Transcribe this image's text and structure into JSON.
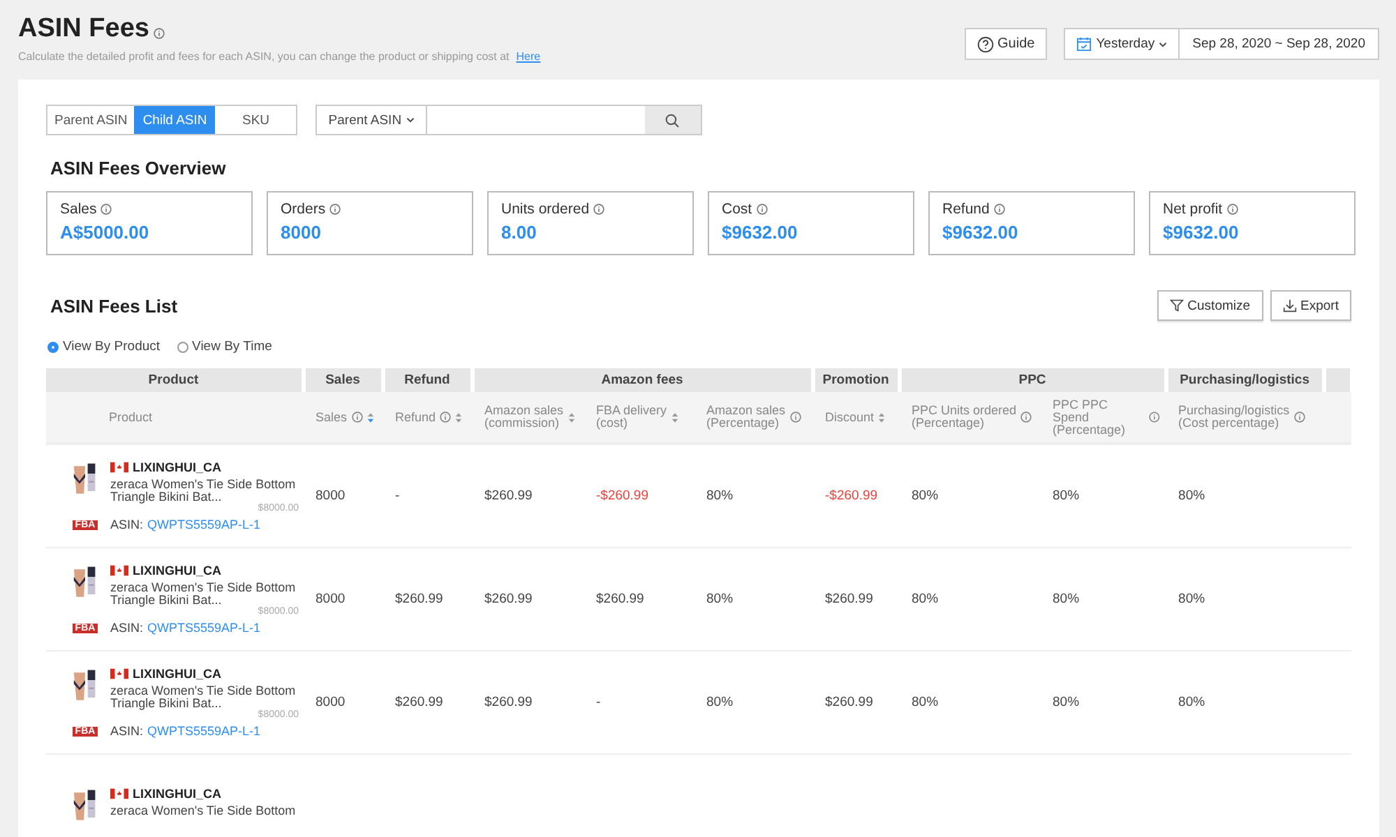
{
  "header": {
    "title": "ASIN Fees",
    "subtitle": "Calculate the detailed profit and fees for each ASIN, you can change the product or shipping cost at",
    "subtitle_link": "Here",
    "guide_button": "Guide",
    "period": "Yesterday",
    "date_range": "Sep 28, 2020 ~ Sep 28, 2020"
  },
  "tabs": [
    {
      "label": "Parent ASIN",
      "selected": false
    },
    {
      "label": "Child ASIN",
      "selected": true
    },
    {
      "label": "SKU",
      "selected": false
    }
  ],
  "search": {
    "scope": "Parent ASIN"
  },
  "overview": {
    "title": "ASIN Fees Overview",
    "cards": [
      {
        "label": "Sales",
        "value": "A$5000.00"
      },
      {
        "label": "Orders",
        "value": "8000"
      },
      {
        "label": "Units ordered",
        "value": "8.00"
      },
      {
        "label": "Cost",
        "value": "$9632.00"
      },
      {
        "label": "Refund",
        "value": "$9632.00"
      },
      {
        "label": "Net profit",
        "value": "$9632.00"
      }
    ]
  },
  "list": {
    "title": "ASIN Fees List",
    "buttons": [
      "Customize",
      "Export"
    ],
    "views": [
      {
        "label": "View By Product",
        "selected": true
      },
      {
        "label": "View By Time",
        "selected": false
      }
    ]
  },
  "table": {
    "groups": [
      {
        "label": "Product"
      },
      {
        "label": "Sales"
      },
      {
        "label": "Refund"
      },
      {
        "label": "Amazon fees"
      },
      {
        "label": "Promotion"
      },
      {
        "label": "PPC"
      },
      {
        "label": "Purchasing/logistics"
      }
    ],
    "columns": [
      {
        "label": "Product",
        "info": false,
        "sortable": false
      },
      {
        "label": "Sales",
        "info": true,
        "sortable": true,
        "sort_active": true
      },
      {
        "label": "Refund",
        "info": true,
        "sortable": true,
        "sort_active": false
      },
      {
        "label": "Amazon sales\n(commission)",
        "info": false,
        "sortable": true,
        "sort_active": false
      },
      {
        "label": "FBA delivery\n(cost)",
        "info": false,
        "sortable": true,
        "sort_active": false
      },
      {
        "label": "Amazon sales\n(Percentage)",
        "info": true,
        "sortable": false
      },
      {
        "label": "Discount",
        "info": false,
        "sortable": true,
        "sort_active": false
      },
      {
        "label": "PPC Units ordered\n(Percentage)",
        "info": true,
        "sortable": false
      },
      {
        "label": "PPC PPC Spend\n(Percentage)",
        "info": true,
        "sortable": false
      },
      {
        "label": "Purchasing/logistics\n(Cost percentage)",
        "info": true,
        "sortable": false
      }
    ],
    "rows": [
      {
        "shop": "LIXINGHUI_CA",
        "title": "zeraca Women's Tie Side Bottom Triangle Bikini Bat...",
        "price": "$8000.00",
        "fulfillment": "FBA",
        "asin_label": "ASIN:",
        "asin": "QWPTS5559AP-L-1",
        "cells": [
          {
            "text": "8000",
            "negative": false
          },
          {
            "text": "-",
            "negative": false
          },
          {
            "text": "$260.99",
            "negative": false
          },
          {
            "text": "-$260.99",
            "negative": true
          },
          {
            "text": "80%",
            "negative": false
          },
          {
            "text": "-$260.99",
            "negative": true
          },
          {
            "text": "80%",
            "negative": false
          },
          {
            "text": "80%",
            "negative": false
          },
          {
            "text": "80%",
            "negative": false
          }
        ]
      },
      {
        "shop": "LIXINGHUI_CA",
        "title": "zeraca Women's Tie Side Bottom Triangle Bikini Bat...",
        "price": "$8000.00",
        "fulfillment": "FBA",
        "asin_label": "ASIN:",
        "asin": "QWPTS5559AP-L-1",
        "cells": [
          {
            "text": "8000",
            "negative": false
          },
          {
            "text": "$260.99",
            "negative": false
          },
          {
            "text": "$260.99",
            "negative": false
          },
          {
            "text": "$260.99",
            "negative": false
          },
          {
            "text": "80%",
            "negative": false
          },
          {
            "text": "$260.99",
            "negative": false
          },
          {
            "text": "80%",
            "negative": false
          },
          {
            "text": "80%",
            "negative": false
          },
          {
            "text": "80%",
            "negative": false
          }
        ]
      },
      {
        "shop": "LIXINGHUI_CA",
        "title": "zeraca Women's Tie Side Bottom Triangle Bikini Bat...",
        "price": "$8000.00",
        "fulfillment": "FBA",
        "asin_label": "ASIN:",
        "asin": "QWPTS5559AP-L-1",
        "cells": [
          {
            "text": "8000",
            "negative": false
          },
          {
            "text": "$260.99",
            "negative": false
          },
          {
            "text": "$260.99",
            "negative": false
          },
          {
            "text": "-",
            "negative": false
          },
          {
            "text": "80%",
            "negative": false
          },
          {
            "text": "$260.99",
            "negative": false
          },
          {
            "text": "80%",
            "negative": false
          },
          {
            "text": "80%",
            "negative": false
          },
          {
            "text": "80%",
            "negative": false
          }
        ]
      },
      {
        "shop": "LIXINGHUI_CA",
        "title": "zeraca Women's Tie Side Bottom"
      }
    ]
  }
}
